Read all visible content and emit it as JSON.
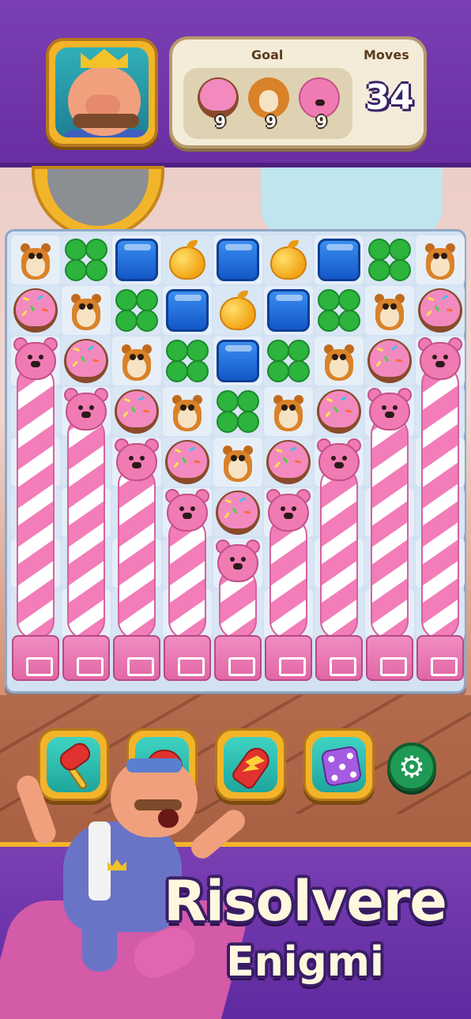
{
  "hud": {
    "goal_label": "Goal",
    "moves_label": "Moves",
    "moves_left": "34",
    "goals": [
      {
        "icon": "donut-icon",
        "count": "9"
      },
      {
        "icon": "chipmunk-icon",
        "count": "9"
      },
      {
        "icon": "bear-icon",
        "count": "9"
      }
    ]
  },
  "board": {
    "columns": 9,
    "rows": 9,
    "grid": [
      [
        "chipmunk",
        "clover",
        "block",
        "apple",
        "block",
        "apple",
        "block",
        "clover",
        "chipmunk"
      ],
      [
        "donut",
        "chipmunk",
        "clover",
        "block",
        "apple",
        "block",
        "clover",
        "chipmunk",
        "donut"
      ],
      [
        "bear",
        "donut",
        "chipmunk",
        "clover",
        "block",
        "clover",
        "chipmunk",
        "donut",
        "bear"
      ],
      [
        "pole",
        "bear",
        "donut",
        "chipmunk",
        "clover",
        "chipmunk",
        "donut",
        "bear",
        "pole"
      ],
      [
        "pole",
        "pole",
        "bear",
        "donut",
        "chipmunk",
        "donut",
        "bear",
        "pole",
        "pole"
      ],
      [
        "pole",
        "pole",
        "pole",
        "bear",
        "donut",
        "bear",
        "pole",
        "pole",
        "pole"
      ],
      [
        "pole",
        "pole",
        "pole",
        "pole",
        "bear",
        "pole",
        "pole",
        "pole",
        "pole"
      ],
      [
        "pole",
        "pole",
        "pole",
        "pole",
        "pole",
        "pole",
        "pole",
        "pole",
        "pole"
      ],
      [
        "base",
        "base",
        "base",
        "base",
        "base",
        "base",
        "base",
        "base",
        "base"
      ]
    ]
  },
  "boosters": [
    {
      "name": "hammer-booster",
      "icon": "hammer-icon"
    },
    {
      "name": "glove-booster",
      "icon": "glove-icon"
    },
    {
      "name": "rocket-booster",
      "icon": "rocket-icon"
    },
    {
      "name": "dice-booster",
      "icon": "dice-icon"
    }
  ],
  "settings": {
    "icon": "gear-icon",
    "glyph": "⚙"
  },
  "promo": {
    "title": "Risolvere",
    "subtitle": "Enigmi"
  },
  "colors": {
    "hud_purple": "#6a2ea3",
    "frame_gold": "#f3b42a",
    "board_bg": "#d3e2f3",
    "candy_pink": "#f27db8"
  }
}
